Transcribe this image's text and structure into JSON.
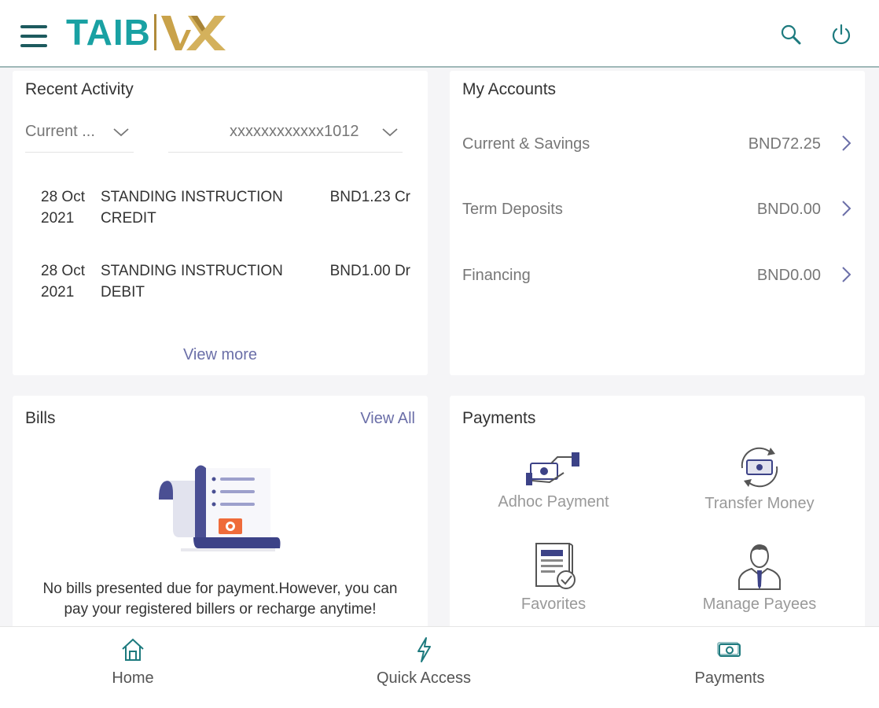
{
  "header": {
    "logo_text": "TAIB",
    "menu_icon": "hamburger-menu-icon",
    "search_icon": "search-icon",
    "power_icon": "power-icon",
    "brand_color": "#19a1a3",
    "accent_color": "#b08a3a"
  },
  "recent_activity": {
    "title": "Recent Activity",
    "account_type": "Current ...",
    "account_number": "xxxxxxxxxxxx1012",
    "transactions": [
      {
        "date_day": "28 Oct",
        "date_year": "2021",
        "desc_line1": "STANDING INSTRUCTION",
        "desc_line2": "CREDIT",
        "amount": "BND1.23 Cr"
      },
      {
        "date_day": "28 Oct",
        "date_year": "2021",
        "desc_line1": "STANDING INSTRUCTION",
        "desc_line2": "DEBIT",
        "amount": "BND1.00 Dr"
      }
    ],
    "view_more": "View more"
  },
  "accounts": {
    "title": "My Accounts",
    "items": [
      {
        "name": "Current & Savings",
        "amount": "BND72.25"
      },
      {
        "name": "Term Deposits",
        "amount": "BND0.00"
      },
      {
        "name": "Financing",
        "amount": "BND0.00"
      }
    ]
  },
  "bills": {
    "title": "Bills",
    "view_all": "View All",
    "message_line1": "No bills presented due for payment.However, you can",
    "message_line2": "pay your registered billers or recharge anytime!"
  },
  "payments": {
    "title": "Payments",
    "items": [
      {
        "label": "Adhoc Payment",
        "icon": "adhoc-payment-icon"
      },
      {
        "label": "Transfer Money",
        "icon": "transfer-money-icon"
      },
      {
        "label": "Favorites",
        "icon": "favorites-icon"
      },
      {
        "label": "Manage Payees",
        "icon": "manage-payees-icon"
      }
    ]
  },
  "bottom_nav": {
    "items": [
      {
        "label": "Home",
        "icon": "home-icon"
      },
      {
        "label": "Quick Access",
        "icon": "lightning-icon"
      },
      {
        "label": "Payments",
        "icon": "money-icon"
      }
    ]
  }
}
